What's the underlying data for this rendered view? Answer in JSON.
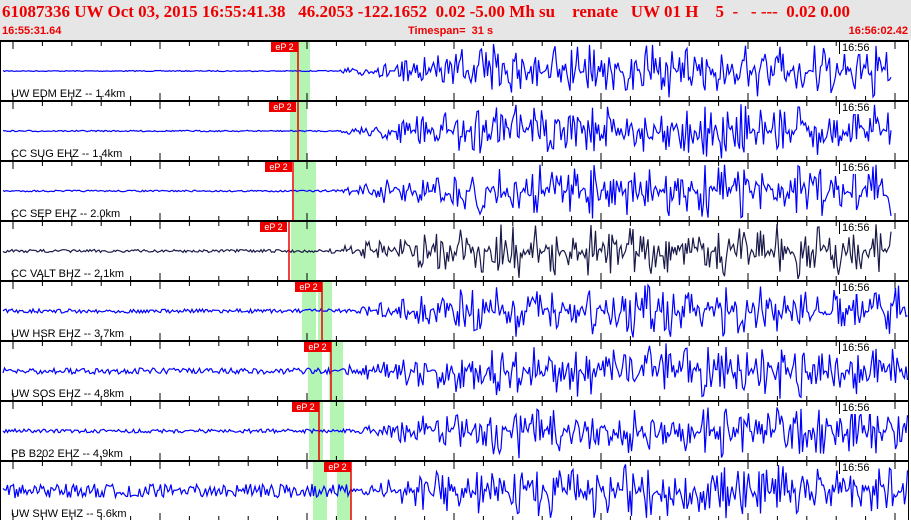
{
  "header": {
    "title": "61087336 UW Oct 03, 2015 16:55:41.38   46.2053 -122.1652  0.02 -5.00 Mh su    renate   UW 01 H    5  -   - ---  0.02 0.00",
    "start_time": "16:55:31.64",
    "timespan": "Timespan=  31 s",
    "end_time": "16:56:02.42"
  },
  "colors": {
    "trace": "#0000ff",
    "trace_dark": "#1a1a4a",
    "pick": "#ee0000",
    "window": "#b4f5b4"
  },
  "minute_label": "16:56",
  "pick_label": "eP 2",
  "channels": [
    {
      "label": "UW EDM EHZ -- 1.4km"
    },
    {
      "label": "CC SUG EHZ -- 1.4km"
    },
    {
      "label": "CC SEP EHZ -- 2.0km"
    },
    {
      "label": "CC VALT BHZ -- 2.1km"
    },
    {
      "label": "UW HSR EHZ -- 3.7km"
    },
    {
      "label": "UW SOS EHZ -- 4.8km"
    },
    {
      "label": "PB B202 EHZ -- 4.9km"
    },
    {
      "label": "UW SHW EHZ -- 5.6km"
    }
  ]
}
